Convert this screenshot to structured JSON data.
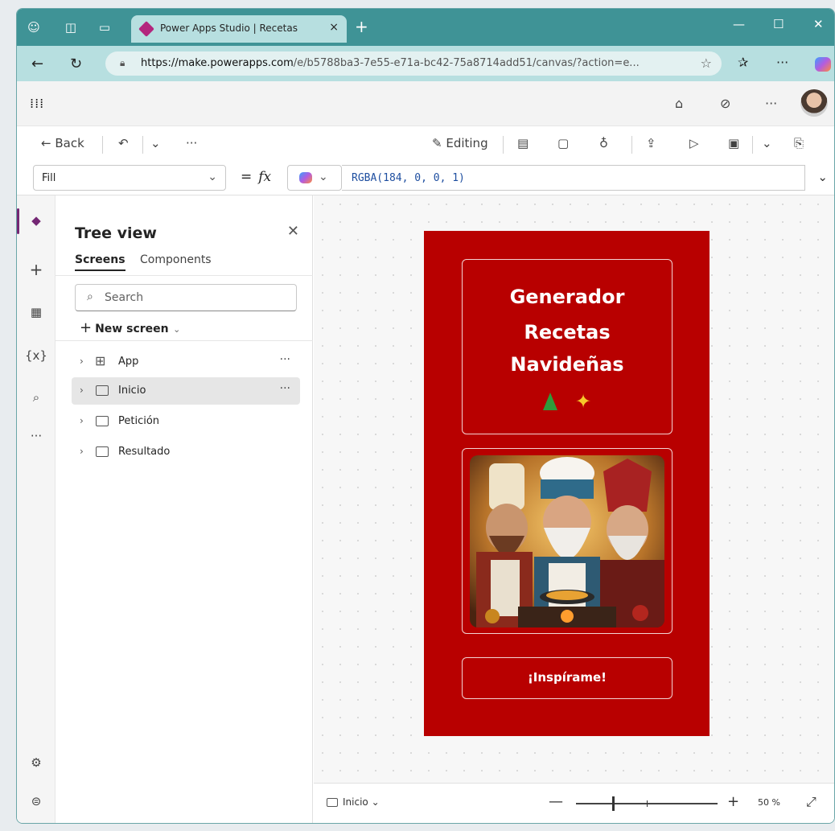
{
  "browser": {
    "tab_title": "Power Apps Studio | Recetas",
    "tab_close": "×",
    "new_tab": "+",
    "url_host": "https://make.powerapps.com",
    "url_path": "/e/b5788ba3-7e55-e71a-bc42-75a8714add51/canvas/?action=e..."
  },
  "commandbar": {
    "back_label": "Back",
    "editing_label": "Editing"
  },
  "formula_bar": {
    "property": "Fill",
    "equals": "=",
    "fx": "fx",
    "formula": "RGBA(184, 0, 0, 1)"
  },
  "tree_view": {
    "title": "Tree view",
    "tabs": [
      "Screens",
      "Components"
    ],
    "search_placeholder": "Search",
    "new_screen_label": "New screen",
    "nodes": [
      {
        "label": "App",
        "type": "app",
        "more": "···"
      },
      {
        "label": "Inicio",
        "type": "screen",
        "more": "···"
      },
      {
        "label": "Petición",
        "type": "screen",
        "more": ""
      },
      {
        "label": "Resultado",
        "type": "screen",
        "more": ""
      }
    ]
  },
  "app_screen": {
    "background": "#b80000",
    "title_lines": [
      "Generador",
      "Recetas",
      "Navideñas"
    ],
    "button_label": "¡Inspírame!"
  },
  "status_bar": {
    "screen_name": "Inicio",
    "zoom": "50 %",
    "zoom_fraction": 0.5
  },
  "icons": [
    "profile-icon",
    "workspaces-icon",
    "tab-actions-icon",
    "back-arrow-icon",
    "refresh-icon",
    "lock-icon",
    "favorite-star-icon",
    "favorites-icon",
    "more-icon",
    "copilot-icon",
    "waffle-icon",
    "environment-icon",
    "undo-icon",
    "pencil-icon",
    "comment-icon",
    "stethoscope-icon",
    "share-icon",
    "play-icon",
    "save-icon",
    "publish-icon",
    "layers-icon",
    "plus-icon",
    "data-icon",
    "variables-icon",
    "search-icon",
    "settings-icon",
    "bot-icon",
    "close-icon",
    "chevron-down-icon",
    "fit-to-window-icon"
  ]
}
